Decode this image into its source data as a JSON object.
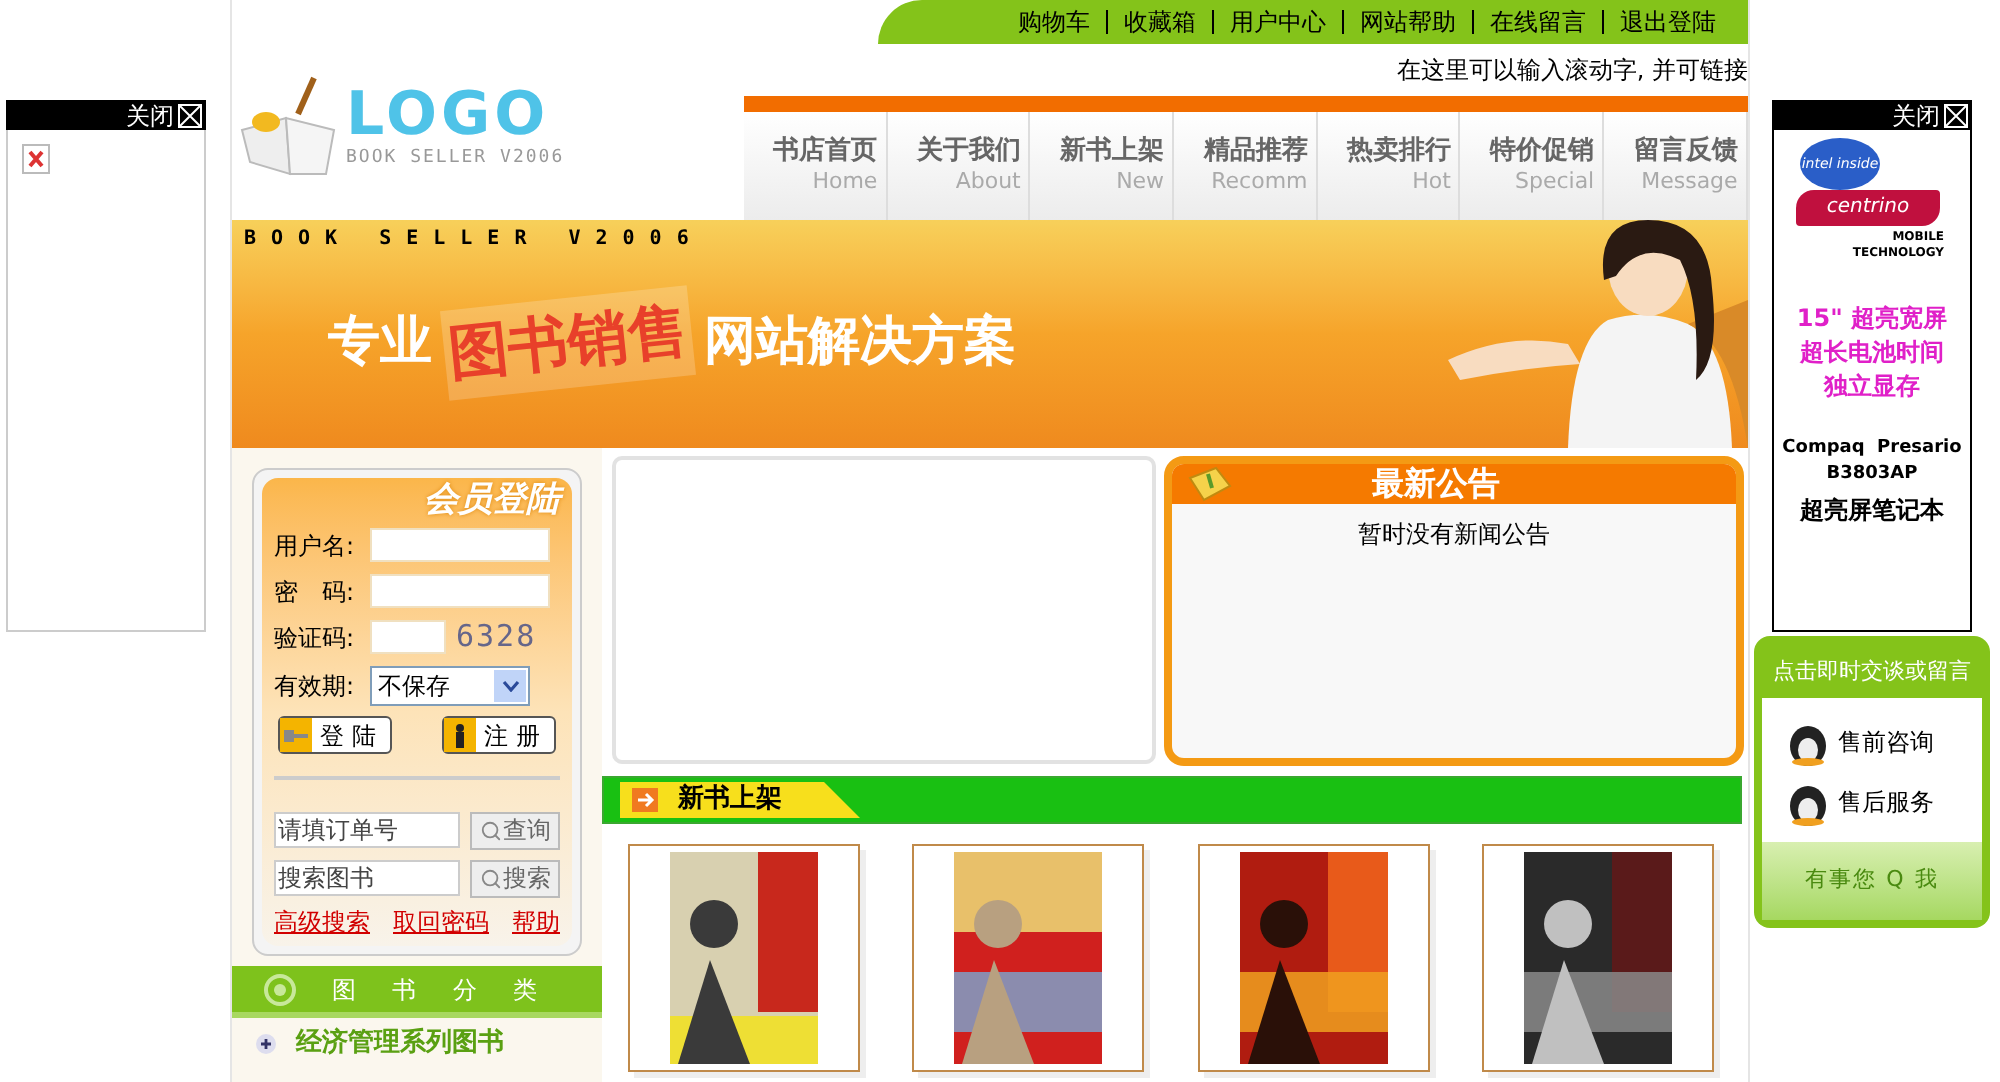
{
  "left_float_ad": {
    "close_label": "关闭"
  },
  "top_links": [
    "购物车",
    "收藏箱",
    "用户中心",
    "网站帮助",
    "在线留言",
    "退出登陆"
  ],
  "logo": {
    "title": "LOGO",
    "subtitle": "BOOK SELLER V2006"
  },
  "marquee": "在这里可以输入滚动字, 并可链接",
  "nav": [
    {
      "label": "书店首页",
      "en": "Home"
    },
    {
      "label": "关于我们",
      "en": "About"
    },
    {
      "label": "新书上架",
      "en": "New"
    },
    {
      "label": "精品推荐",
      "en": "Recomm"
    },
    {
      "label": "热卖排行",
      "en": "Hot"
    },
    {
      "label": "特价促销",
      "en": "Special"
    },
    {
      "label": "留言反馈",
      "en": "Message"
    }
  ],
  "banner": {
    "caption": "BOOK SELLER V2006",
    "slogan_start": "专业",
    "slogan_highlight": "图书销售",
    "slogan_end": "网站解决方案"
  },
  "login": {
    "title": "会员登陆",
    "fields": [
      {
        "label": "用户名:"
      },
      {
        "label": "密　码:"
      },
      {
        "label": "验证码:",
        "code": "6328"
      }
    ],
    "expiry": {
      "label": "有效期:",
      "value": "不保存"
    },
    "buttons": [
      {
        "kind": "key",
        "label": "登 陆"
      },
      {
        "kind": "person",
        "label": "注 册"
      }
    ]
  },
  "searches": [
    {
      "placeholder": "请填订单号",
      "button": "查询"
    },
    {
      "placeholder": "搜索图书",
      "button": "搜索"
    }
  ],
  "links": [
    "高级搜索",
    "取回密码",
    "帮助"
  ],
  "categories": {
    "title": "图 书 分 类",
    "items": [
      "经济管理系列图书"
    ]
  },
  "notice": {
    "title": "最新公告",
    "text": "暂时没有新闻公告"
  },
  "new_books": {
    "title": "新书上架"
  },
  "right_float_ad": {
    "close_label": "关闭",
    "logo_top": "intel inside",
    "logo_name": "centrino",
    "logo_sub": "MOBILE TECHNOLOGY",
    "lines": [
      "15\" 超亮宽屏",
      "超长电池时间",
      "独立显存"
    ],
    "model": [
      "Compaq  Presario",
      "B3803AP"
    ],
    "tagline": "超亮屏笔记本"
  },
  "chat_widget": {
    "title": "点击即时交谈或留言",
    "contacts": [
      "售前咨询",
      "售后服务"
    ],
    "footer": "有事您 Q 我"
  }
}
